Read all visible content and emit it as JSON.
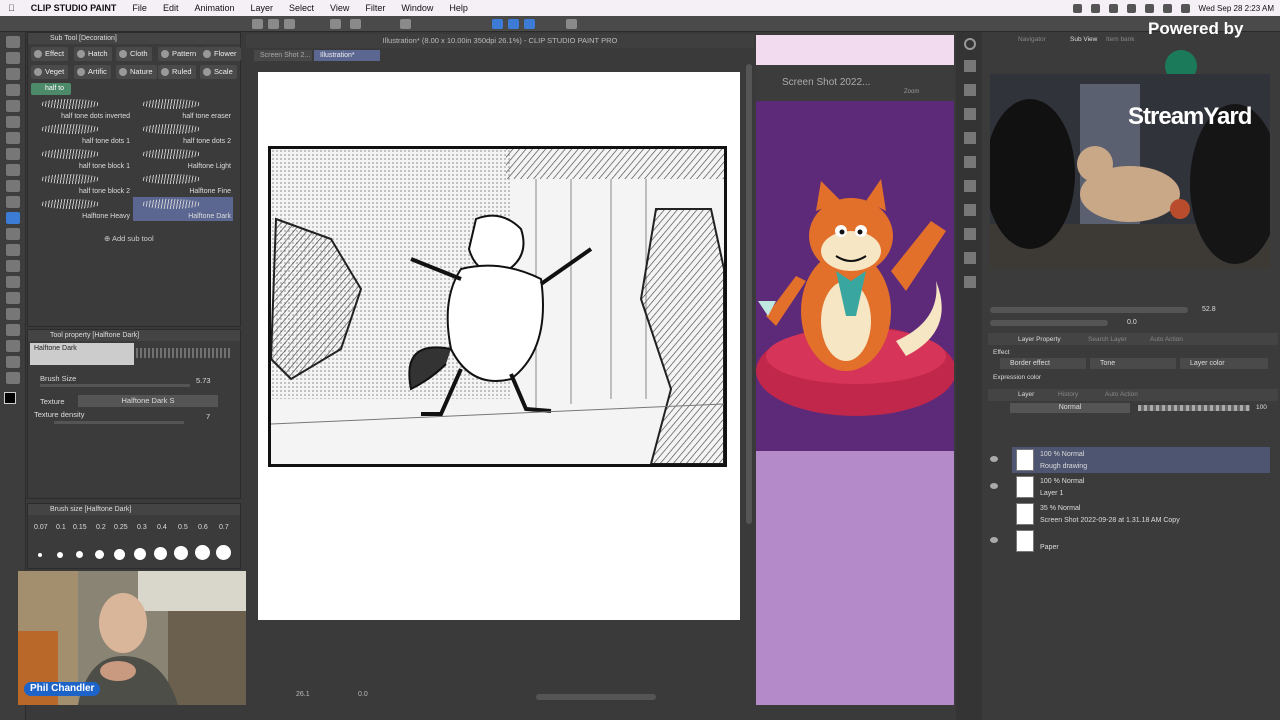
{
  "menubar": {
    "app_name": "CLIP STUDIO PAINT",
    "items": [
      "File",
      "Edit",
      "Animation",
      "Layer",
      "Select",
      "View",
      "Filter",
      "Window",
      "Help"
    ],
    "datetime": "Wed Sep 28 2:23 AM"
  },
  "document_title": "Illustration* (8.00 x 10.00in 350dpi 26.1%) - CLIP STUDIO PAINT PRO",
  "canvas_tabs": [
    "Screen Shot 2...",
    "Illustration*"
  ],
  "subtool_panel": {
    "title": "Sub Tool [Decoration]",
    "tags": [
      "Effect",
      "Hatch",
      "Cloth",
      "Pattern",
      "Flower",
      "Veget",
      "Artific",
      "Nature",
      "Ruled",
      "Scale"
    ],
    "search_value": "half to",
    "brushes": [
      "half tone dots inverted",
      "half tone eraser",
      "half tone dots 1",
      "half tone dots 2",
      "half tone block 1",
      "Halftone Light",
      "half tone block 2",
      "Halftone Fine",
      "Halftone Heavy",
      "Halftone Dark"
    ],
    "add_label": "Add sub tool"
  },
  "tool_property": {
    "title": "Tool property [Halftone Dark]",
    "preset_name": "Halftone Dark",
    "brush_size_label": "Brush Size",
    "brush_size_value": "5.73",
    "texture_label": "Texture",
    "texture_value": "Halftone Dark S",
    "texture_density_label": "Texture density",
    "texture_density_value": "7"
  },
  "brush_size_panel": {
    "title": "Brush size [Halftone Dark]",
    "sizes": [
      "0.07",
      "0.1",
      "0.15",
      "0.2",
      "0.25",
      "0.3",
      "0.4",
      "0.5",
      "0.6",
      "0.7"
    ]
  },
  "camera": {
    "name": "Phil Chandler"
  },
  "ref_window": {
    "title": "Screen Shot 2022...",
    "zoom_label": "Zoom"
  },
  "streamyard": {
    "powered_by": "Powered by",
    "brand": "StreamYard"
  },
  "navigator": {
    "tabs": [
      "Navigator",
      "Sub View",
      "Item bank"
    ],
    "zoom": "52.8",
    "rotation": "0.0"
  },
  "layer_property": {
    "tabs": [
      "Layer Property",
      "Search Layer",
      "Auto Action"
    ],
    "effect_label": "Effect",
    "border_effect": "Border effect",
    "tone": "Tone",
    "layer_color": "Layer color",
    "expression_color": "Expression color"
  },
  "layer_panel": {
    "tabs": [
      "Layer",
      "History",
      "Auto Action"
    ],
    "blend_mode": "Normal",
    "opacity": "100",
    "layers": [
      {
        "mode": "100 % Normal",
        "name": "Rough drawing",
        "selected": true
      },
      {
        "mode": "100 % Normal",
        "name": "Layer 1",
        "selected": false
      },
      {
        "mode": "35 % Normal",
        "name": "Screen Shot 2022-09-28 at 1.31.18 AM Copy",
        "selected": false
      },
      {
        "mode": "",
        "name": "Paper",
        "selected": false
      }
    ]
  },
  "canvas_status": {
    "zoom": "26.1",
    "angle": "0.0"
  },
  "colors": {
    "accent": "#1e64c8",
    "selected_row": "#4e5570",
    "ref_bg": "#5f2a7a",
    "cat_orange": "#e3702a",
    "cushion": "#c0274a"
  }
}
